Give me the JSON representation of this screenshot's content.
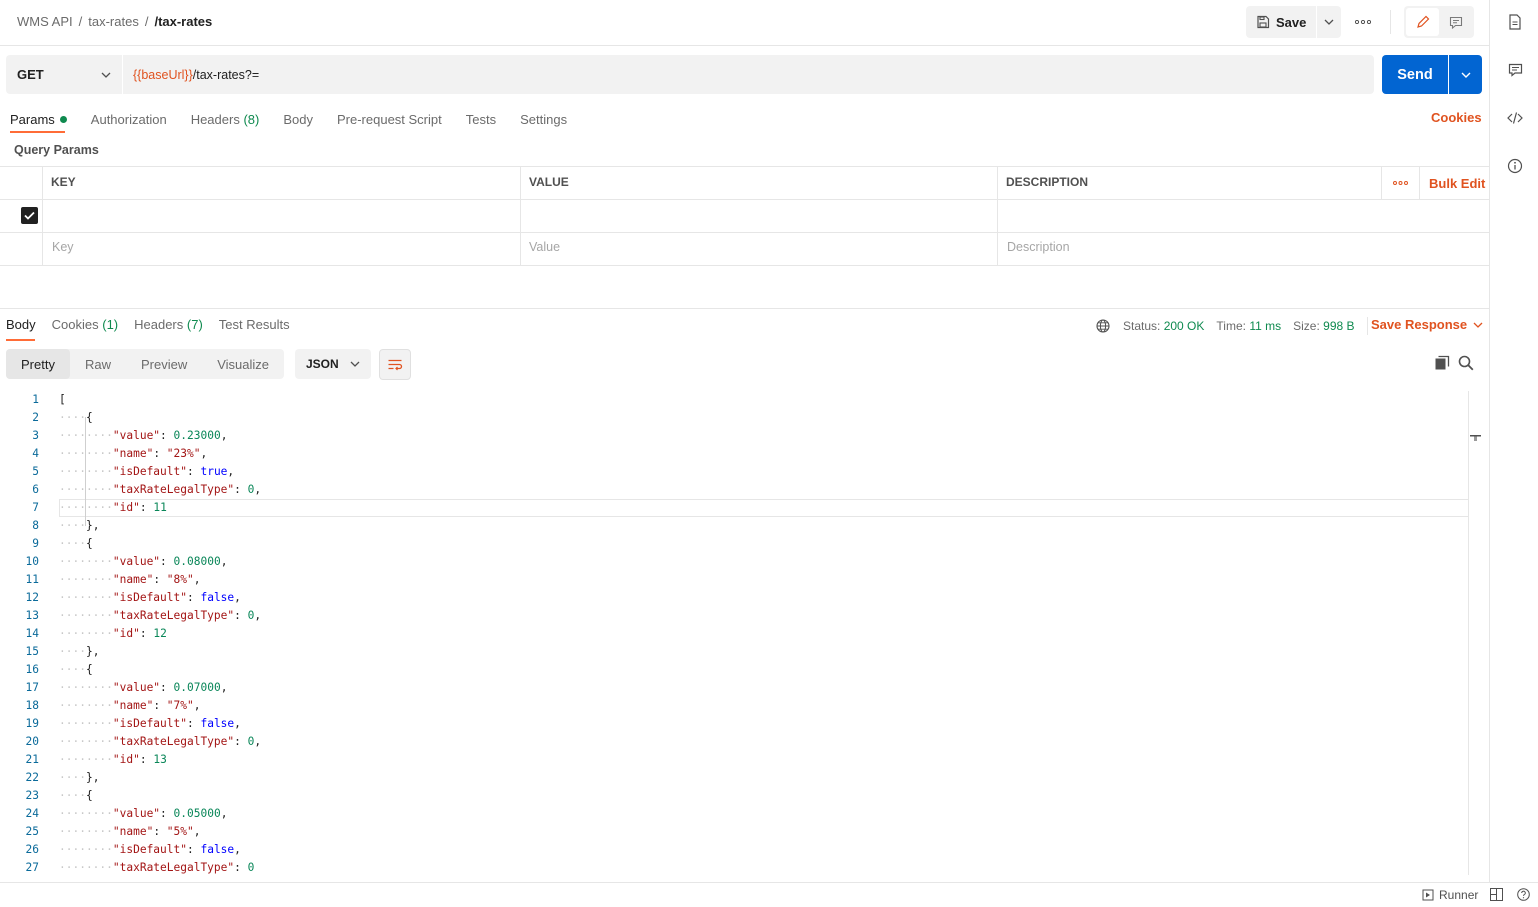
{
  "breadcrumb": {
    "root": "WMS API",
    "folder": "tax-rates",
    "current": "/tax-rates"
  },
  "toolbar": {
    "save_label": "Save"
  },
  "request": {
    "method": "GET",
    "url_variable": "{{baseUrl}}",
    "url_path": "/tax-rates?=",
    "send_label": "Send"
  },
  "request_tabs": [
    {
      "label": "Params"
    },
    {
      "label": "Authorization"
    },
    {
      "label": "Headers",
      "count": "(8)"
    },
    {
      "label": "Body"
    },
    {
      "label": "Pre-request Script"
    },
    {
      "label": "Tests"
    },
    {
      "label": "Settings"
    }
  ],
  "cookies_label": "Cookies",
  "query_params": {
    "title": "Query Params",
    "columns": [
      "KEY",
      "VALUE",
      "DESCRIPTION"
    ],
    "bulk_edit": "Bulk Edit",
    "placeholders": {
      "key": "Key",
      "value": "Value",
      "description": "Description"
    }
  },
  "response_tabs": [
    {
      "label": "Body"
    },
    {
      "label": "Cookies",
      "count": "(1)"
    },
    {
      "label": "Headers",
      "count": "(7)"
    },
    {
      "label": "Test Results"
    }
  ],
  "response_meta": {
    "status_label": "Status:",
    "status_value": "200 OK",
    "time_label": "Time:",
    "time_value": "11 ms",
    "size_label": "Size:",
    "size_value": "998 B",
    "save_response": "Save Response"
  },
  "view_tabs": [
    "Pretty",
    "Raw",
    "Preview",
    "Visualize"
  ],
  "format": "JSON",
  "footer": {
    "runner": "Runner"
  },
  "colors": {
    "accent": "#ff6c37",
    "link": "#e05320",
    "primary": "#0265d2",
    "success": "#0f8a4f"
  },
  "response_body": [
    {
      "value": "0.23000",
      "name": "\"23%\"",
      "isDefault": "true",
      "taxRateLegalType": "0",
      "id": "11"
    },
    {
      "value": "0.08000",
      "name": "\"8%\"",
      "isDefault": "false",
      "taxRateLegalType": "0",
      "id": "12"
    },
    {
      "value": "0.07000",
      "name": "\"7%\"",
      "isDefault": "false",
      "taxRateLegalType": "0",
      "id": "13"
    },
    {
      "value": "0.05000",
      "name": "\"5%\"",
      "isDefault": "false",
      "taxRateLegalType": "0"
    }
  ]
}
